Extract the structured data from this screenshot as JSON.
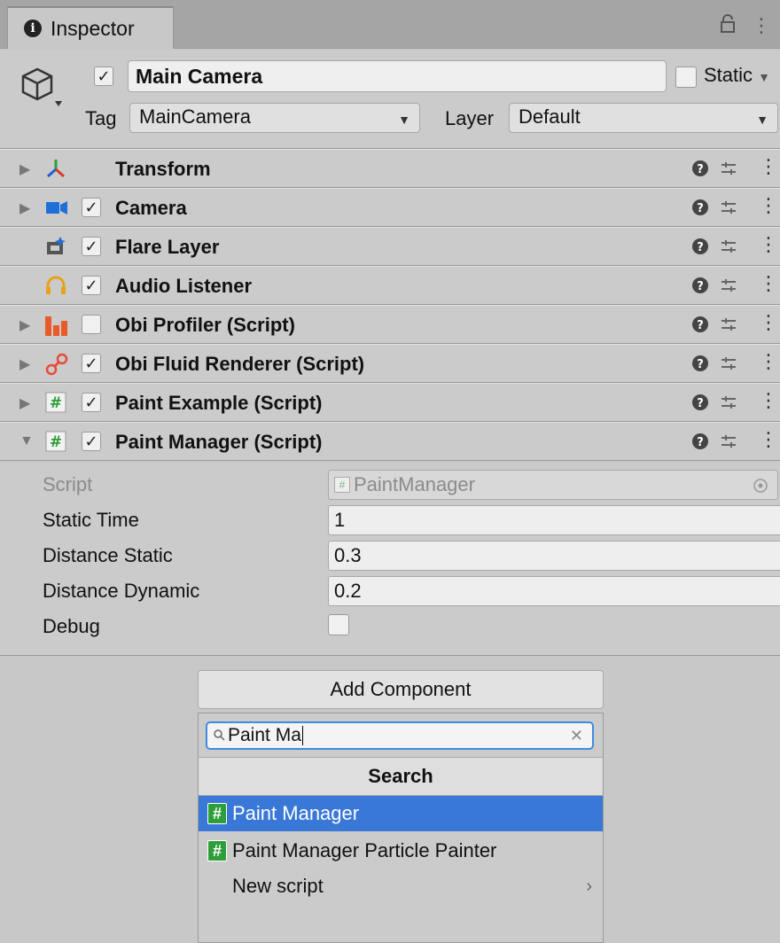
{
  "tab": {
    "title": "Inspector"
  },
  "object": {
    "name": "Main Camera",
    "static_label": "Static",
    "tag_label": "Tag",
    "tag_value": "MainCamera",
    "layer_label": "Layer",
    "layer_value": "Default"
  },
  "components": [
    {
      "name": "Transform",
      "icon": "transform-icon",
      "checkbox": false,
      "checked": false,
      "foldout": "collapsed"
    },
    {
      "name": "Camera",
      "icon": "camera-icon",
      "checkbox": true,
      "checked": true,
      "foldout": "collapsed"
    },
    {
      "name": "Flare Layer",
      "icon": "flare-layer-icon",
      "checkbox": true,
      "checked": true,
      "foldout": "none"
    },
    {
      "name": "Audio Listener",
      "icon": "headphones-icon",
      "checkbox": true,
      "checked": true,
      "foldout": "none"
    },
    {
      "name": "Obi Profiler (Script)",
      "icon": "profiler-icon",
      "checkbox": true,
      "checked": false,
      "foldout": "collapsed"
    },
    {
      "name": "Obi Fluid Renderer (Script)",
      "icon": "fluid-renderer-icon",
      "checkbox": true,
      "checked": true,
      "foldout": "collapsed"
    },
    {
      "name": "Paint Example (Script)",
      "icon": "script-icon",
      "checkbox": true,
      "checked": true,
      "foldout": "collapsed"
    },
    {
      "name": "Paint Manager (Script)",
      "icon": "script-icon",
      "checkbox": true,
      "checked": true,
      "foldout": "expanded"
    }
  ],
  "properties": {
    "script_label": "Script",
    "script_value": "PaintManager",
    "static_time_label": "Static Time",
    "static_time_value": "1",
    "distance_static_label": "Distance Static",
    "distance_static_value": "0.3",
    "distance_dynamic_label": "Distance Dynamic",
    "distance_dynamic_value": "0.2",
    "debug_label": "Debug"
  },
  "add_component": {
    "button_label": "Add Component",
    "search_value": "Paint Ma",
    "search_header": "Search",
    "results": [
      "Paint Manager",
      "Paint Manager Particle Painter"
    ],
    "new_script": "New script"
  },
  "colors": {
    "selection": "#3a78d8",
    "script_icon": "#2e9e3a",
    "focus_border": "#3e8ce0"
  }
}
